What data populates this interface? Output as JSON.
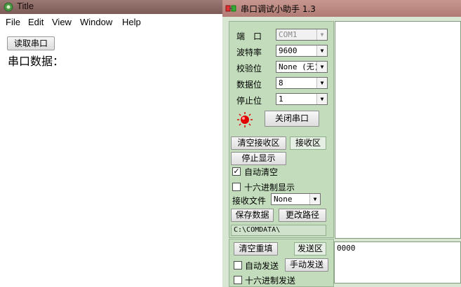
{
  "left_window": {
    "title": "Title",
    "menu": [
      "File",
      "Edit",
      "View",
      "Window",
      "Help"
    ],
    "read_button": "读取串口",
    "data_label": "串口数据："
  },
  "serial_window": {
    "title": "串口调试小助手 1.3",
    "settings": {
      "port_label": "端　口",
      "port_value": "COM1",
      "baud_label": "波特率",
      "baud_value": "9600",
      "parity_label": "校验位",
      "parity_value": "None (无)",
      "databits_label": "数据位",
      "databits_value": "8",
      "stopbits_label": "停止位",
      "stopbits_value": "1"
    },
    "port_status": {
      "led_color": "#e00000",
      "toggle_button": "关闭串口"
    },
    "receive": {
      "clear_button": "清空接收区",
      "area_tag": "接收区",
      "stop_button": "停止显示",
      "auto_clear_label": "自动清空",
      "auto_clear_checked": true,
      "hex_display_label": "十六进制显示",
      "hex_display_checked": false,
      "file_label": "接收文件",
      "file_value": "None",
      "save_button": "保存数据",
      "change_path_button": "更改路径",
      "path": "C:\\COMDATA\\"
    },
    "send": {
      "clear_button": "清空重填",
      "area_tag": "发送区",
      "auto_send_label": "自动发送",
      "auto_send_checked": false,
      "manual_send_button": "手动发送",
      "hex_send_label": "十六进制发送",
      "hex_send_checked": false,
      "text": "0000"
    }
  }
}
